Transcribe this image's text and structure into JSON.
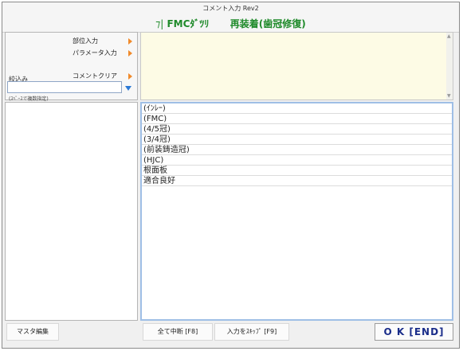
{
  "window": {
    "title": "コメント入力 Rev2",
    "heading_glyph": "⁊|",
    "heading_left": "FMCﾀﾞﾂﾘ",
    "heading_right": "再装着(歯冠修復)"
  },
  "left_panel": {
    "buttons": [
      {
        "label": "部位入力"
      },
      {
        "label": "パラメータ入力"
      },
      {
        "label": "コメントクリア"
      }
    ],
    "filter_label": "絞込み",
    "filter_value": "",
    "filter_hint": "(ｽﾍﾟｰｽで複数指定)"
  },
  "comments": [
    "(ｲﾝﾚｰ)",
    "(FMC)",
    "(4/5冠)",
    "(3/4冠)",
    "(前装鋳造冠)",
    "(HJC)",
    "根面板",
    "適合良好"
  ],
  "footer": {
    "master_edit": "マスタ編集",
    "cancel_all": "全て中断 [F8]",
    "skip_input": "入力をｽｷｯﾌﾟ [F9]",
    "ok": "O K [END]"
  },
  "colors": {
    "heading_green": "#1f8a2a",
    "preview_bg": "#fdfbe5",
    "arrow_orange": "#f08a2b",
    "dropdown_blue": "#2b79d6",
    "ok_text": "#1a2d8a"
  }
}
